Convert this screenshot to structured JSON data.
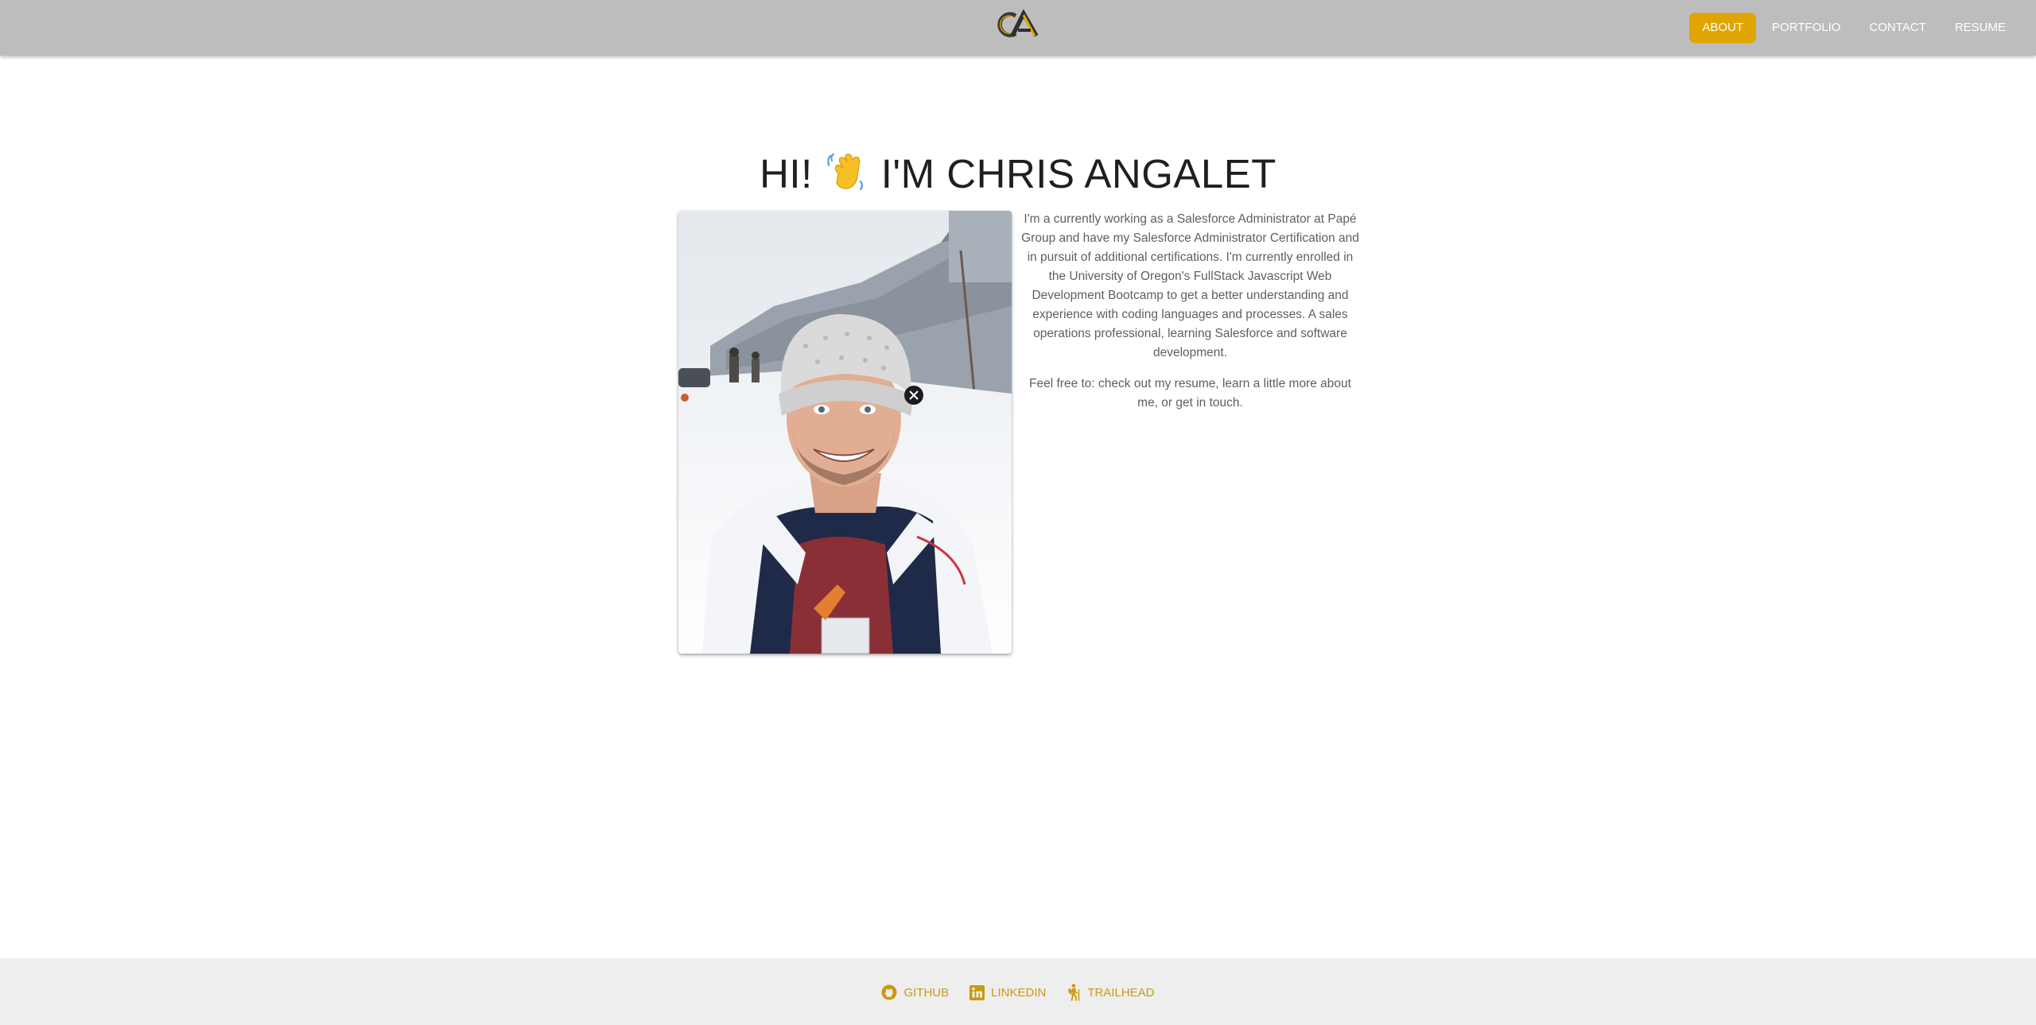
{
  "header": {
    "logo_alt": "CA",
    "nav": [
      {
        "label": "ABOUT",
        "active": true
      },
      {
        "label": "PORTFOLIO",
        "active": false
      },
      {
        "label": "CONTACT",
        "active": false
      },
      {
        "label": "RESUME",
        "active": false
      }
    ]
  },
  "main": {
    "title_part1": "HI!",
    "title_icon": "waving-hand-icon",
    "title_part2": "I'M CHRIS ANGALET",
    "photo_icon": "profile-photo",
    "bio_paragraph1": "I'm a currently working as a Salesforce Administrator at Papé Group and have my Salesforce Administrator Certification and in pursuit of additional certifications. I'm currently enrolled in the University of Oregon's FullStack Javascript Web Development Bootcamp to get a better understanding and experience with coding languages and processes. A sales operations professional, learning Salesforce and software development.",
    "bio_paragraph2": "Feel free to: check out my resume, learn a little more about me, or get in touch."
  },
  "footer": {
    "links": [
      {
        "label": "GITHUB",
        "icon": "github-icon"
      },
      {
        "label": "LINKEDIN",
        "icon": "linkedin-icon"
      },
      {
        "label": "TRAILHEAD",
        "icon": "hiker-icon"
      }
    ]
  },
  "colors": {
    "navbar_bg": "#bdbdbd",
    "accent": "#e0a500",
    "footer_bg": "#eeeeee",
    "footer_link": "#c99a10"
  }
}
